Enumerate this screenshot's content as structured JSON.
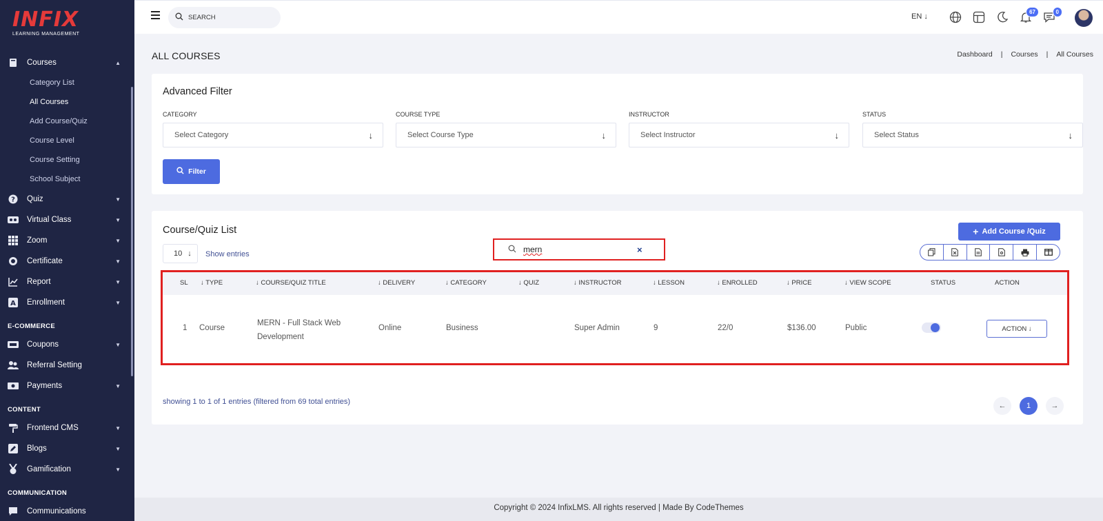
{
  "brand": {
    "name": "INFIX",
    "tagline": "LEARNING MANAGEMENT"
  },
  "sidebar": {
    "courses": {
      "label": "Courses",
      "icon": "book-icon"
    },
    "course_subitems": [
      "Category List",
      "All Courses",
      "Add Course/Quiz",
      "Course Level",
      "Course Setting",
      "School Subject"
    ],
    "items": [
      {
        "label": "Quiz",
        "icon": "question-icon"
      },
      {
        "label": "Virtual Class",
        "icon": "vr-icon"
      },
      {
        "label": "Zoom",
        "icon": "grid-icon"
      },
      {
        "label": "Certificate",
        "icon": "badge-icon"
      },
      {
        "label": "Report",
        "icon": "chart-icon"
      },
      {
        "label": "Enrollment",
        "icon": "enroll-icon"
      }
    ],
    "section_ecommerce": "E-COMMERCE",
    "ecommerce_items": [
      {
        "label": "Coupons",
        "icon": "ticket-icon"
      },
      {
        "label": "Referral Setting",
        "icon": "users-icon"
      },
      {
        "label": "Payments",
        "icon": "money-icon"
      }
    ],
    "section_content": "CONTENT",
    "content_items": [
      {
        "label": "Frontend CMS",
        "icon": "paint-roller-icon"
      },
      {
        "label": "Blogs",
        "icon": "edit-icon"
      },
      {
        "label": "Gamification",
        "icon": "medal-icon"
      }
    ],
    "section_communication": "COMMUNICATION",
    "communication_items": [
      {
        "label": "Communications",
        "icon": "chat-icon"
      }
    ]
  },
  "topbar": {
    "search_placeholder": "SEARCH",
    "language": "EN",
    "notifications_count": "67",
    "messages_count": "0"
  },
  "page": {
    "title": "ALL COURSES",
    "breadcrumb": [
      "Dashboard",
      "Courses",
      "All Courses"
    ]
  },
  "filter": {
    "title": "Advanced Filter",
    "fields": [
      {
        "label": "CATEGORY",
        "placeholder": "Select Category"
      },
      {
        "label": "COURSE TYPE",
        "placeholder": "Select Course Type"
      },
      {
        "label": "INSTRUCTOR",
        "placeholder": "Select Instructor"
      },
      {
        "label": "STATUS",
        "placeholder": "Select Status"
      }
    ],
    "button": "Filter"
  },
  "list": {
    "title": "Course/Quiz List",
    "add_button": "Add Course /Quiz",
    "page_length": "10",
    "show_entries": "Show entries",
    "search_value": "mern",
    "columns": [
      "SL",
      "TYPE",
      "COURSE/QUIZ TITLE",
      "DELIVERY",
      "CATEGORY",
      "QUIZ",
      "INSTRUCTOR",
      "LESSON",
      "ENROLLED",
      "PRICE",
      "VIEW SCOPE",
      "STATUS",
      "ACTION"
    ],
    "rows": [
      {
        "sl": "1",
        "type": "Course",
        "title_line1": "MERN - Full Stack Web",
        "title_line2": "Development",
        "delivery": "Online",
        "category": "Business",
        "quiz": "",
        "instructor": "Super Admin",
        "lesson": "9",
        "enrolled": "22/0",
        "price": "$136.00",
        "view_scope": "Public",
        "status_on": true,
        "action": "ACTION"
      }
    ],
    "info": "showing 1 to 1 of 1 entries (filtered from 69 total entries)",
    "current_page": "1"
  },
  "footer": {
    "text": "Copyright © 2024 InfixLMS. All rights reserved | Made By CodeThemes"
  },
  "colors": {
    "sidebar_bg": "#1f2544",
    "primary": "#4d6be0",
    "highlight": "#e02020",
    "brand_red": "#e53a3a"
  }
}
